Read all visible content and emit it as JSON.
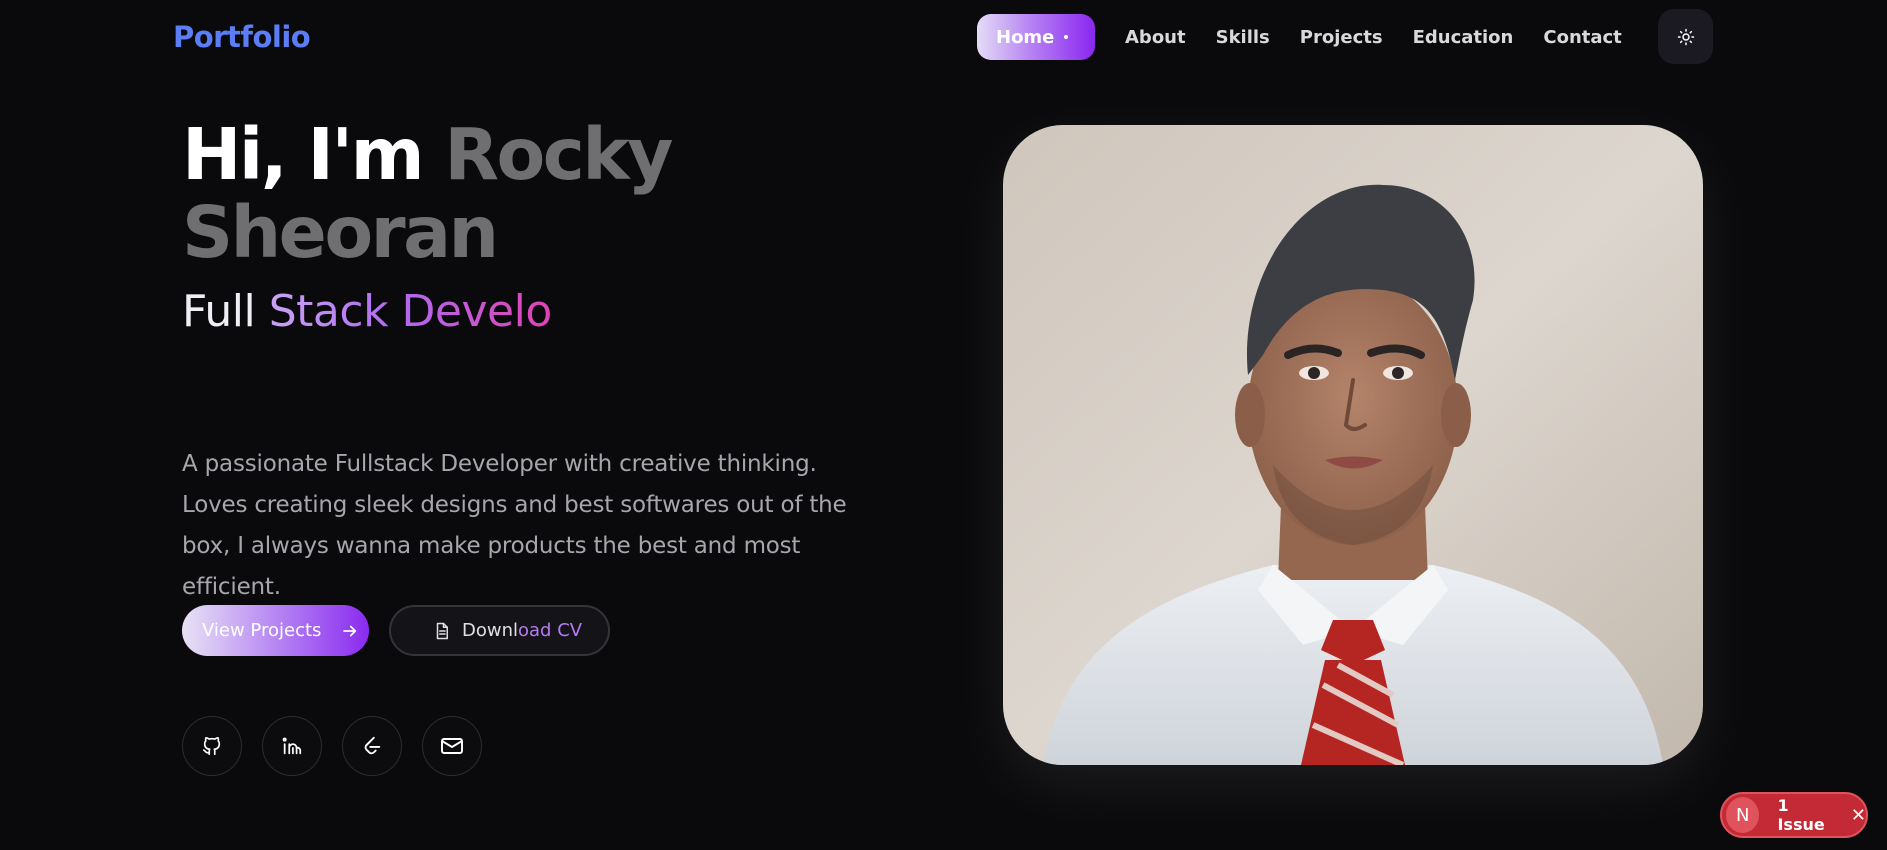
{
  "brand": "Portfolio",
  "nav": {
    "home": "Home",
    "items": [
      "About",
      "Skills",
      "Projects",
      "Education",
      "Contact"
    ],
    "theme_icon": "sun-icon"
  },
  "hero": {
    "greeting": "Hi, I'm ",
    "name": "Rocky Sheoran",
    "role_prefix": "Full ",
    "role_rest": "Stack Develo",
    "description": "A passionate Fullstack Developer with creative thinking. Loves creating sleek designs and best softwares out of the box, I always wanna make products the best and most efficient."
  },
  "buttons": {
    "primary": "View Projects",
    "primary_icon": "arrow-right-icon",
    "secondary_a": "Downl",
    "secondary_b": "oad CV",
    "secondary_icon": "document-icon"
  },
  "socials": [
    "github-icon",
    "linkedin-icon",
    "leetcode-icon",
    "mail-icon"
  ],
  "issue_badge": {
    "letter": "N",
    "label": "1 Issue",
    "close": "✕"
  },
  "colors": {
    "background": "#0a0a0c",
    "brand": "#5b7df5",
    "accent_purple": "#8a27f0",
    "accent_pink": "#e043b4",
    "issue_red": "#c42a35"
  }
}
